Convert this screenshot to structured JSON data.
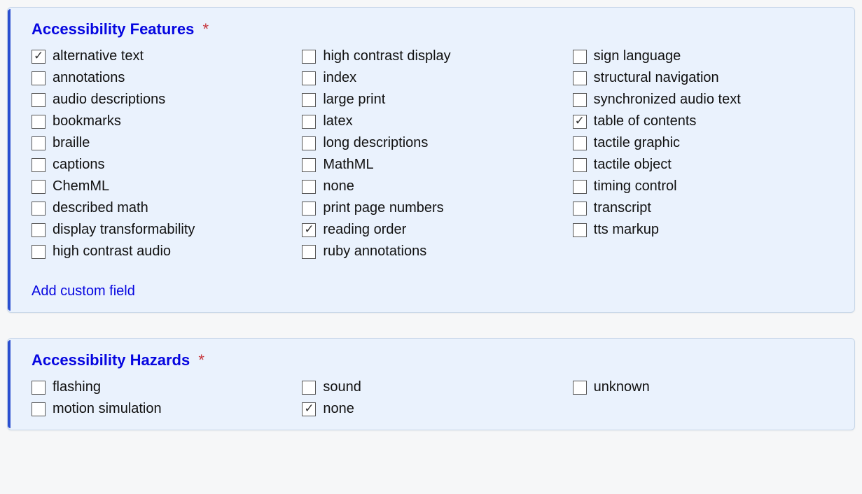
{
  "features": {
    "title": "Accessibility Features",
    "required_mark": "*",
    "add_custom_label": "Add custom field",
    "options": [
      {
        "label": "alternative text",
        "checked": true
      },
      {
        "label": "annotations",
        "checked": false
      },
      {
        "label": "audio descriptions",
        "checked": false
      },
      {
        "label": "bookmarks",
        "checked": false
      },
      {
        "label": "braille",
        "checked": false
      },
      {
        "label": "captions",
        "checked": false
      },
      {
        "label": "ChemML",
        "checked": false
      },
      {
        "label": "described math",
        "checked": false
      },
      {
        "label": "display transformability",
        "checked": false
      },
      {
        "label": "high contrast audio",
        "checked": false
      },
      {
        "label": "high contrast display",
        "checked": false
      },
      {
        "label": "index",
        "checked": false
      },
      {
        "label": "large print",
        "checked": false
      },
      {
        "label": "latex",
        "checked": false
      },
      {
        "label": "long descriptions",
        "checked": false
      },
      {
        "label": "MathML",
        "checked": false
      },
      {
        "label": "none",
        "checked": false
      },
      {
        "label": "print page numbers",
        "checked": false
      },
      {
        "label": "reading order",
        "checked": true
      },
      {
        "label": "ruby annotations",
        "checked": false
      },
      {
        "label": "sign language",
        "checked": false
      },
      {
        "label": "structural navigation",
        "checked": false
      },
      {
        "label": "synchronized audio text",
        "checked": false
      },
      {
        "label": "table of contents",
        "checked": true
      },
      {
        "label": "tactile graphic",
        "checked": false
      },
      {
        "label": "tactile object",
        "checked": false
      },
      {
        "label": "timing control",
        "checked": false
      },
      {
        "label": "transcript",
        "checked": false
      },
      {
        "label": "tts markup",
        "checked": false
      }
    ]
  },
  "hazards": {
    "title": "Accessibility Hazards",
    "required_mark": "*",
    "options": [
      {
        "label": "flashing",
        "checked": false
      },
      {
        "label": "motion simulation",
        "checked": false
      },
      {
        "label": "sound",
        "checked": false
      },
      {
        "label": "none",
        "checked": true
      },
      {
        "label": "unknown",
        "checked": false
      }
    ]
  }
}
